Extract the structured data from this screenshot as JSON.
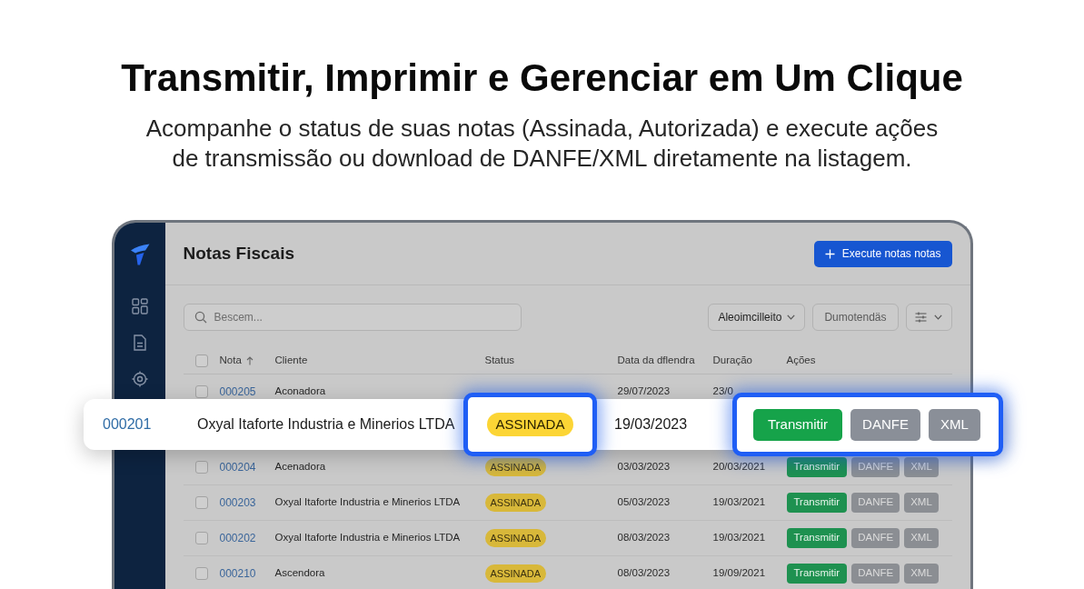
{
  "headline": {
    "title": "Transmitir, Imprimir e Gerenciar em Um Clique",
    "subtitle": "Acompanhe o status de suas notas (Assinada, Autorizada) e execute ações\nde transmissão ou download de DANFE/XML diretamente na listagem."
  },
  "app": {
    "page_title": "Notas Fiscais",
    "primary_button": {
      "label": "Execute notas notas"
    },
    "search": {
      "placeholder": "Bescem..."
    },
    "filters": [
      {
        "kind": "dropdown",
        "label": "Aleoimcilleito"
      },
      {
        "kind": "button",
        "label": "Dumotendäs"
      },
      {
        "kind": "view_menu"
      }
    ],
    "table": {
      "select_all": {
        "checked": false
      },
      "columns": [
        {
          "label": "Nota",
          "sorted": true
        },
        {
          "label": "Cliente",
          "sorted": false
        },
        {
          "label": "Status",
          "sorted": false
        },
        {
          "label": "Data da dflendra",
          "sorted": false
        },
        {
          "label": "Duração",
          "sorted": false
        },
        {
          "label": "Ações",
          "sorted": false
        }
      ],
      "rows": [
        {
          "highlighted": false,
          "checked": false,
          "nota": "000205",
          "cliente": "Aconadora",
          "data": "29/07/2023",
          "duracao": "23/0"
        },
        {
          "highlighted": true,
          "nota": "000201",
          "cliente": "Oxyal Itaforte Industria e Minerios LTDA",
          "status": "ASSINADA",
          "data": "19/03/2023",
          "actions": [
            {
              "kind": "transmit",
              "label": "Transmitir"
            },
            {
              "kind": "download",
              "label": "DANFE"
            },
            {
              "kind": "download",
              "label": "XML"
            }
          ]
        },
        {
          "highlighted": false,
          "checked": false,
          "nota": "000204",
          "cliente": "Acenadora",
          "status": "ASSINADA",
          "data": "03/03/2023",
          "duracao": "20/03/2021",
          "actions": [
            {
              "kind": "transmit",
              "label": "Transmitir"
            },
            {
              "kind": "download",
              "label": "DANFE"
            },
            {
              "kind": "download",
              "label": "XML"
            }
          ]
        },
        {
          "highlighted": false,
          "checked": false,
          "nota": "000203",
          "cliente": "Oxyal Itaforte Industria e Minerios LTDA",
          "status": "ASSINADA",
          "data": "05/03/2023",
          "duracao": "19/03/2021",
          "actions": [
            {
              "kind": "transmit",
              "label": "Transmitir"
            },
            {
              "kind": "download",
              "label": "DANFE"
            },
            {
              "kind": "download",
              "label": "XML"
            }
          ]
        },
        {
          "highlighted": false,
          "checked": false,
          "nota": "000202",
          "cliente": "Oxyal Itaforte Industria e Minerios LTDA",
          "status": "ASSINADA",
          "data": "08/03/2023",
          "duracao": "19/03/2021",
          "actions": [
            {
              "kind": "transmit",
              "label": "Transmitir"
            },
            {
              "kind": "download",
              "label": "DANFE"
            },
            {
              "kind": "download",
              "label": "XML"
            }
          ]
        },
        {
          "highlighted": false,
          "checked": false,
          "nota": "000210",
          "cliente": "Ascendora",
          "status": "ASSINADA",
          "data": "08/03/2023",
          "duracao": "19/09/2021",
          "actions": [
            {
              "kind": "transmit",
              "label": "Transmitir"
            },
            {
              "kind": "download",
              "label": "DANFE"
            },
            {
              "kind": "download",
              "label": "XML"
            }
          ]
        }
      ]
    }
  }
}
